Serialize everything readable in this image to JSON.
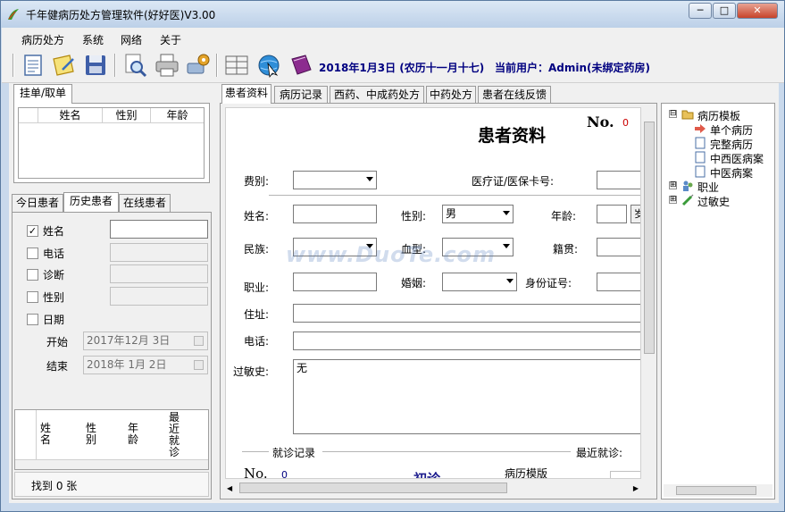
{
  "window": {
    "title": "千年健病历处方管理软件(好好医)V3.00",
    "controls": {
      "minimize": "─",
      "maximize": "□",
      "close": "✕"
    }
  },
  "menu": [
    "病历处方",
    "系统",
    "网络",
    "关于"
  ],
  "toolbar": {
    "icons": [
      "document-icon",
      "notepad-icon",
      "save-icon",
      "search-icon",
      "printer-icon",
      "gear-printer-icon",
      "grid-icon",
      "globe-cursor-icon",
      "book-icon"
    ],
    "date_text": "2018年1月3日 (农历十一月十七)",
    "user_text": "当前用户：Admin(未绑定药房)"
  },
  "left": {
    "queue_tab": "挂单/取单",
    "queue_columns": [
      "姓名",
      "性别",
      "年龄"
    ],
    "patient_tabs": [
      "今日患者",
      "历史患者",
      "在线患者"
    ],
    "filters": [
      {
        "label": "姓名",
        "checked": true
      },
      {
        "label": "电话",
        "checked": false
      },
      {
        "label": "诊断",
        "checked": false
      },
      {
        "label": "性别",
        "checked": false
      },
      {
        "label": "日期",
        "checked": false
      }
    ],
    "start_label": "开始",
    "start_date": "2017年12月 3日",
    "end_label": "结束",
    "end_date": "2018年 1月 2日",
    "result_columns": [
      "姓名",
      "性别",
      "年龄",
      "最近就诊"
    ],
    "found_text": "找到 0 张"
  },
  "center": {
    "tabs": [
      "患者资料",
      "病历记录",
      "西药、中成药处方",
      "中药处方",
      "患者在线反馈"
    ],
    "no_label": "No.",
    "no_value": "0",
    "heading": "患者资料",
    "labels": {
      "fee": "费别:",
      "card": "医疗证/医保卡号:",
      "name": "姓名:",
      "gender": "性别:",
      "age": "年龄:",
      "age_unit": "岁",
      "ethnic": "民族:",
      "blood": "血型:",
      "native": "籍贯:",
      "job": "职业:",
      "marriage": "婚姻:",
      "idcard": "身份证号:",
      "address": "住址:",
      "phone": "电话:",
      "allergy": "过敏史:"
    },
    "gender_value": "男",
    "allergy_value": "无",
    "visit_record_label": "就诊记录",
    "recent_visit_label": "最近就诊:",
    "visit_no_label": "No.",
    "visit_no_value": "0",
    "first_visit": "初诊",
    "template_label": "病历模版"
  },
  "tree": {
    "items": [
      {
        "label": "病历模板",
        "level": 0,
        "expander": "⊟",
        "icon": "folder-icon"
      },
      {
        "label": "单个病历",
        "level": 1,
        "icon": "arrow-icon"
      },
      {
        "label": "完整病历",
        "level": 1,
        "icon": "page-icon"
      },
      {
        "label": "中西医病案",
        "level": 1,
        "icon": "page-icon"
      },
      {
        "label": "中医病案",
        "level": 1,
        "icon": "page-icon"
      },
      {
        "label": "职业",
        "level": 0,
        "expander": "⊞",
        "icon": "people-icon"
      },
      {
        "label": "过敏史",
        "level": 0,
        "expander": "⊞",
        "icon": "syringe-icon"
      }
    ]
  },
  "watermark": "www.DuoTe.com",
  "colors": {
    "titlebar": "#c9d9ec",
    "info_text": "#000080",
    "no_value": "#cc0000",
    "first_visit": "#1a1a8c"
  }
}
